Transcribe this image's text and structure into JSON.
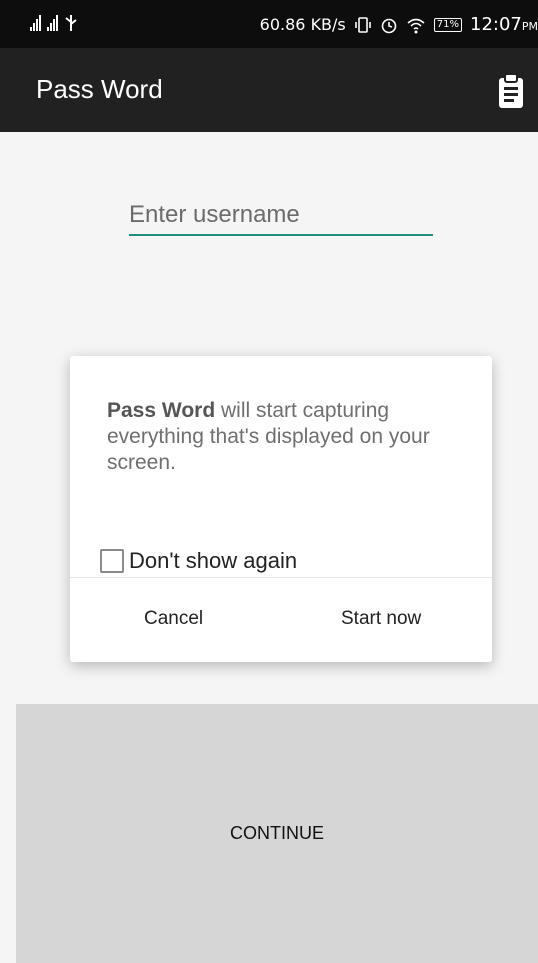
{
  "status_bar": {
    "speed": "60.86 KB/s",
    "battery": "71%",
    "time": "12:07",
    "ampm": "PM"
  },
  "app_bar": {
    "title": "Pass Word",
    "action_icon": "clipboard-icon"
  },
  "form": {
    "username_placeholder": "Enter username",
    "username_value": ""
  },
  "dialog": {
    "app_name": "Pass Word",
    "message": " will start capturing everything that's displayed on your screen.",
    "checkbox_label": "Don't show again",
    "checkbox_checked": false,
    "cancel_label": "Cancel",
    "start_label": "Start now"
  },
  "continue_label": "CONTINUE",
  "colors": {
    "accent": "#1e8f7e",
    "app_bar": "#212121",
    "status_bar": "#0d0d0d",
    "continue_bg": "#d5d6d5"
  }
}
